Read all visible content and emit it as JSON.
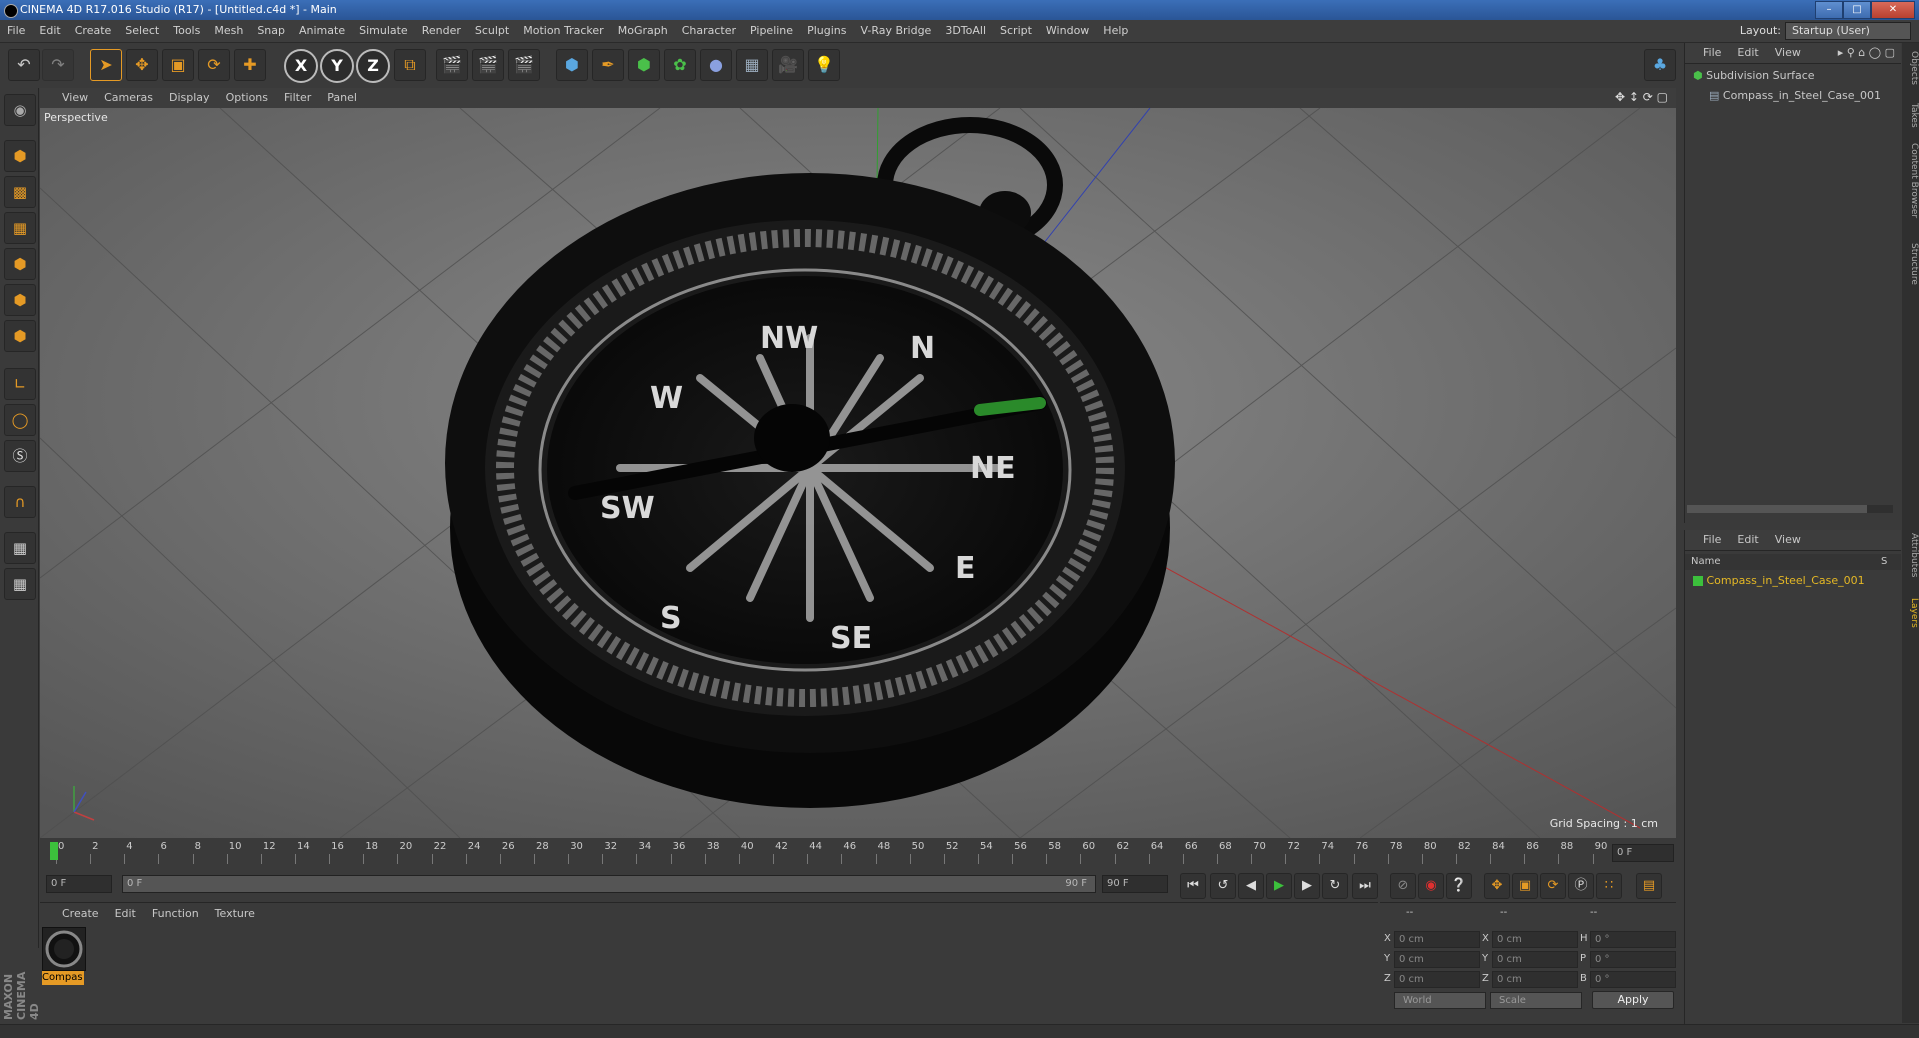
{
  "window": {
    "title": "CINEMA 4D R17.016 Studio (R17) - [Untitled.c4d *] - Main",
    "min": "–",
    "max": "□",
    "close": "✕"
  },
  "menu": [
    "File",
    "Edit",
    "Create",
    "Select",
    "Tools",
    "Mesh",
    "Snap",
    "Animate",
    "Simulate",
    "Render",
    "Sculpt",
    "Motion Tracker",
    "MoGraph",
    "Character",
    "Pipeline",
    "Plugins",
    "V-Ray Bridge",
    "3DToAll",
    "Script",
    "Window",
    "Help"
  ],
  "layout": {
    "label": "Layout:",
    "value": "Startup (User)"
  },
  "viewport": {
    "menu": [
      "View",
      "Cameras",
      "Display",
      "Options",
      "Filter",
      "Panel"
    ],
    "camera": "Perspective",
    "grid_spacing": "Grid Spacing : 1 cm",
    "compass_labels": [
      "NW",
      "N",
      "NE",
      "E",
      "SE",
      "S",
      "SW",
      "W"
    ]
  },
  "timeline": {
    "ticks": [
      "0",
      "2",
      "4",
      "6",
      "8",
      "10",
      "12",
      "14",
      "16",
      "18",
      "20",
      "22",
      "24",
      "26",
      "28",
      "30",
      "32",
      "34",
      "36",
      "38",
      "40",
      "42",
      "44",
      "46",
      "48",
      "50",
      "52",
      "54",
      "56",
      "58",
      "60",
      "62",
      "64",
      "66",
      "68",
      "70",
      "72",
      "74",
      "76",
      "78",
      "80",
      "82",
      "84",
      "86",
      "88",
      "90"
    ],
    "current_frame": "0 F",
    "start": "0 F",
    "range_start": "0 F",
    "range_end": "90 F",
    "end": "90 F"
  },
  "material_manager": {
    "menu": [
      "Create",
      "Edit",
      "Function",
      "Texture"
    ],
    "material_name": "Compas"
  },
  "coordinates": {
    "header": [
      "--",
      "--",
      "--"
    ],
    "rows": [
      {
        "a": "X",
        "pos": "0 cm",
        "b": "X",
        "size": "0 cm",
        "c": "H",
        "rot": "0 °"
      },
      {
        "a": "Y",
        "pos": "0 cm",
        "b": "Y",
        "size": "0 cm",
        "c": "P",
        "rot": "0 °"
      },
      {
        "a": "Z",
        "pos": "0 cm",
        "b": "Z",
        "size": "0 cm",
        "c": "B",
        "rot": "0 °"
      }
    ],
    "mode": "World",
    "transform": "Scale",
    "apply": "Apply"
  },
  "object_manager": {
    "menu": [
      "File",
      "Edit",
      "View"
    ],
    "items": [
      "Subdivision Surface",
      "Compass_in_Steel_Case_001"
    ]
  },
  "layer_manager": {
    "menu": [
      "File",
      "Edit",
      "View"
    ],
    "col_name": "Name",
    "col_s": "S",
    "items": [
      "Compass_in_Steel_Case_001"
    ]
  },
  "side_tabs": [
    "Objects",
    "Takes",
    "Content Browser",
    "Structure",
    "Attributes",
    "Layers"
  ],
  "brand": "MAXON CINEMA 4D",
  "colors": {
    "accent": "#e59a25",
    "layer_green": "#3cc03c",
    "selected_text": "#e5b825"
  }
}
